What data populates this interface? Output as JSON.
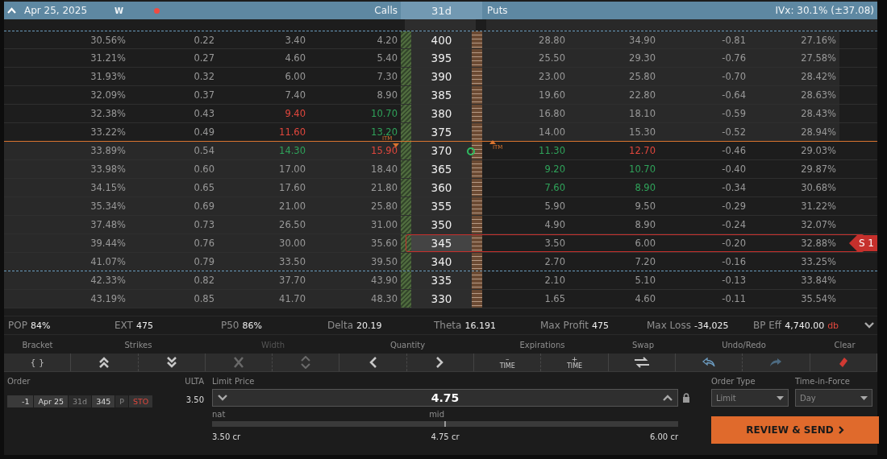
{
  "header": {
    "expanded": true,
    "date": "Apr 25, 2025",
    "badge": "W",
    "calls_label": "Calls",
    "dte": "31d",
    "puts_label": "Puts",
    "ivx": "IVx: 30.1% (±37.08)"
  },
  "itm_labels": [
    "ITM",
    "ITM"
  ],
  "rows": [
    {
      "strike": "400",
      "calls": [
        "30.56%",
        "0.22",
        "3.40",
        "4.20"
      ],
      "puts": [
        "28.80",
        "34.90",
        "-0.81",
        "27.16%"
      ],
      "call_itm": false,
      "put_itm": true,
      "bound_below": false,
      "bound_above": true,
      "atm_below": false,
      "marker": false,
      "selected": false
    },
    {
      "strike": "395",
      "calls": [
        "31.21%",
        "0.27",
        "4.60",
        "5.40"
      ],
      "puts": [
        "25.50",
        "29.30",
        "-0.76",
        "27.58%"
      ],
      "call_itm": false,
      "put_itm": true,
      "bound_below": false,
      "atm_below": false,
      "marker": false,
      "selected": false
    },
    {
      "strike": "390",
      "calls": [
        "31.93%",
        "0.32",
        "6.00",
        "7.30"
      ],
      "puts": [
        "23.00",
        "25.80",
        "-0.70",
        "28.42%"
      ],
      "call_itm": false,
      "put_itm": true,
      "bound_below": false,
      "atm_below": false,
      "marker": false,
      "selected": false
    },
    {
      "strike": "385",
      "calls": [
        "32.09%",
        "0.37",
        "7.40",
        "8.90"
      ],
      "puts": [
        "19.60",
        "22.80",
        "-0.64",
        "28.63%"
      ],
      "call_itm": false,
      "put_itm": true,
      "bound_below": false,
      "atm_below": false,
      "marker": false,
      "selected": false
    },
    {
      "strike": "380",
      "calls": [
        "32.38%",
        "0.43",
        {
          "text": "9.40",
          "color": "#e2473d"
        },
        {
          "text": "10.70",
          "color": "#2fa35a"
        }
      ],
      "puts": [
        "16.80",
        "18.10",
        "-0.59",
        "28.43%"
      ],
      "call_itm": false,
      "put_itm": true,
      "bound_below": false,
      "atm_below": false,
      "marker": false,
      "selected": false
    },
    {
      "strike": "375",
      "calls": [
        "33.22%",
        "0.49",
        {
          "text": "11.60",
          "color": "#e2473d"
        },
        {
          "text": "13.20",
          "color": "#2fa35a"
        }
      ],
      "puts": [
        "14.00",
        "15.30",
        "-0.52",
        "28.94%"
      ],
      "call_itm": false,
      "put_itm": true,
      "bound_below": false,
      "atm_below": true,
      "marker": false,
      "selected": false
    },
    {
      "strike": "370",
      "calls": [
        "33.89%",
        "0.54",
        {
          "text": "14.30",
          "color": "#2fa35a"
        },
        {
          "text": "15.90",
          "color": "#e2473d"
        }
      ],
      "puts": [
        {
          "text": "11.30",
          "color": "#2fa35a"
        },
        {
          "text": "12.70",
          "color": "#e2473d"
        },
        "-0.46",
        "29.03%"
      ],
      "call_itm": true,
      "put_itm": false,
      "bound_below": false,
      "atm_below": false,
      "marker": true,
      "selected": false
    },
    {
      "strike": "365",
      "calls": [
        "33.98%",
        "0.60",
        "17.00",
        "18.40"
      ],
      "puts": [
        {
          "text": "9.20",
          "color": "#2fa35a"
        },
        {
          "text": "10.70",
          "color": "#2fa35a"
        },
        "-0.40",
        "29.87%"
      ],
      "call_itm": true,
      "put_itm": false,
      "bound_below": false,
      "atm_below": false,
      "marker": false,
      "selected": false
    },
    {
      "strike": "360",
      "calls": [
        "34.15%",
        "0.65",
        "17.60",
        "21.80"
      ],
      "puts": [
        {
          "text": "7.60",
          "color": "#2fa35a"
        },
        {
          "text": "8.90",
          "color": "#2fa35a"
        },
        "-0.34",
        "30.68%"
      ],
      "call_itm": true,
      "put_itm": false,
      "bound_below": false,
      "atm_below": false,
      "marker": false,
      "selected": false
    },
    {
      "strike": "355",
      "calls": [
        "35.34%",
        "0.69",
        "21.00",
        "25.80"
      ],
      "puts": [
        "5.90",
        "9.50",
        "-0.29",
        "31.22%"
      ],
      "call_itm": true,
      "put_itm": false,
      "bound_below": false,
      "atm_below": false,
      "marker": false,
      "selected": false
    },
    {
      "strike": "350",
      "calls": [
        "37.48%",
        "0.73",
        "26.50",
        "31.00"
      ],
      "puts": [
        "4.90",
        "8.90",
        "-0.24",
        "32.07%"
      ],
      "call_itm": true,
      "put_itm": false,
      "bound_below": false,
      "atm_below": false,
      "marker": false,
      "selected": false
    },
    {
      "strike": "345",
      "calls": [
        "39.44%",
        "0.76",
        "30.00",
        "35.60"
      ],
      "puts": [
        "3.50",
        "6.00",
        "-0.20",
        "32.88%"
      ],
      "call_itm": true,
      "put_itm": false,
      "bound_below": false,
      "atm_below": false,
      "marker": false,
      "selected": true,
      "badge": "S 1"
    },
    {
      "strike": "340",
      "calls": [
        "41.07%",
        "0.79",
        "33.50",
        "39.50"
      ],
      "puts": [
        "2.70",
        "7.20",
        "-0.16",
        "33.25%"
      ],
      "call_itm": true,
      "put_itm": false,
      "bound_below": true,
      "bound_above": false,
      "atm_below": false,
      "marker": false,
      "selected": false
    },
    {
      "strike": "335",
      "calls": [
        "42.33%",
        "0.82",
        "37.70",
        "43.90"
      ],
      "puts": [
        "2.10",
        "5.10",
        "-0.13",
        "33.84%"
      ],
      "call_itm": true,
      "put_itm": false,
      "bound_below": false,
      "atm_below": false,
      "marker": false,
      "selected": false
    },
    {
      "strike": "330",
      "calls": [
        "43.19%",
        "0.85",
        "41.70",
        "48.30"
      ],
      "puts": [
        "1.65",
        "4.60",
        "-0.11",
        "35.54%"
      ],
      "call_itm": true,
      "put_itm": false,
      "bound_below": false,
      "atm_below": false,
      "marker": false,
      "selected": false
    }
  ],
  "stats": [
    {
      "label": "POP",
      "value": "84%"
    },
    {
      "label": "EXT",
      "value": "475"
    },
    {
      "label": "P50",
      "value": "86%"
    },
    {
      "label": "Delta",
      "value": "20.19"
    },
    {
      "label": "Theta",
      "value": "16.191"
    },
    {
      "label": "Max Profit",
      "value": "475"
    },
    {
      "label": "Max Loss",
      "value": "-34,025"
    },
    {
      "label": "BP Eff",
      "value": "4,740.00",
      "suffix": "db"
    }
  ],
  "toolbar": [
    {
      "label": "Bracket",
      "disabled": false,
      "buttons": [
        {
          "kind": "text",
          "text": "{ }",
          "disabled": false
        }
      ]
    },
    {
      "label": "Strikes",
      "disabled": false,
      "buttons": [
        {
          "kind": "double-up",
          "disabled": false
        },
        {
          "kind": "double-down",
          "disabled": false
        }
      ]
    },
    {
      "label": "Width",
      "disabled": true,
      "buttons": [
        {
          "kind": "cross",
          "disabled": true
        },
        {
          "kind": "up-down",
          "disabled": true
        }
      ]
    },
    {
      "label": "Quantity",
      "disabled": false,
      "buttons": [
        {
          "kind": "left",
          "disabled": false
        },
        {
          "kind": "right",
          "disabled": false
        }
      ]
    },
    {
      "label": "Expirations",
      "disabled": false,
      "buttons": [
        {
          "kind": "time",
          "sign": "–",
          "text": "TIME",
          "disabled": false
        },
        {
          "kind": "time",
          "sign": "+",
          "text": "TIME",
          "disabled": false
        }
      ]
    },
    {
      "label": "Swap",
      "disabled": false,
      "buttons": [
        {
          "kind": "swap",
          "disabled": false
        }
      ]
    },
    {
      "label": "Undo/Redo",
      "disabled": false,
      "buttons": [
        {
          "kind": "undo",
          "disabled": false
        },
        {
          "kind": "redo",
          "disabled": true
        }
      ]
    },
    {
      "label": "Clear",
      "disabled": false,
      "buttons": [
        {
          "kind": "eraser",
          "disabled": false
        }
      ]
    }
  ],
  "order": {
    "label": "Order",
    "legs": [
      {
        "kind": "qty",
        "text": "-1"
      },
      {
        "kind": "date",
        "text": "Apr 25"
      },
      {
        "kind": "muted",
        "text": "31d"
      },
      {
        "kind": "strike",
        "text": "345"
      },
      {
        "kind": "muted",
        "text": "P"
      },
      {
        "kind": "action",
        "text": "STO"
      }
    ],
    "symbol": "ULTA",
    "symbol_price": "3.50",
    "limit_label": "Limit Price",
    "limit_value": "4.75",
    "nat_label": "nat",
    "mid_label": "mid",
    "level": 0.5,
    "nat_price": "3.50 cr",
    "mid_price": "4.75 cr",
    "far_price": "6.00 cr",
    "order_type_label": "Order Type",
    "order_type": "Limit",
    "tif_label": "Time-in-Force",
    "tif": "Day",
    "submit": "REVIEW & SEND"
  }
}
